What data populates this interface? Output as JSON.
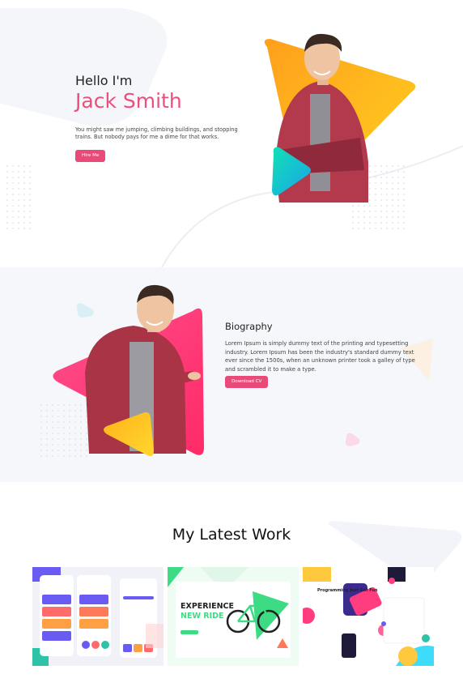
{
  "hero": {
    "greeting": "Hello I'm",
    "name": "Jack Smith",
    "description": "You might saw me jumping, climbing buildings, and stopping trains. But nobody pays for me a dime for that works.",
    "hire_label": "Hire Me"
  },
  "biography": {
    "title": "Biography",
    "text": "Lorem Ipsum is simply dummy text of the printing and typesetting industry. Lorem Ipsum has been the industry's standard dummy text ever since the 1500s, when an unknown printer took a galley of type and scrambled it to make a type.",
    "cv_label": "Download CV"
  },
  "work": {
    "title": "My Latest Work",
    "items": [
      {
        "name": "mobile-app-shot"
      },
      {
        "name": "bike-landing-shot",
        "headline_1": "EXPERIENCE",
        "headline_2": "NEW RIDE"
      },
      {
        "name": "programming-landing-shot",
        "headline": "Programming Just Got Fun"
      }
    ]
  },
  "colors": {
    "accent_pink": "#ea4a78",
    "orange": "#ffaa1f",
    "teal": "#19d3c5",
    "section_bg": "#f6f7fb"
  }
}
